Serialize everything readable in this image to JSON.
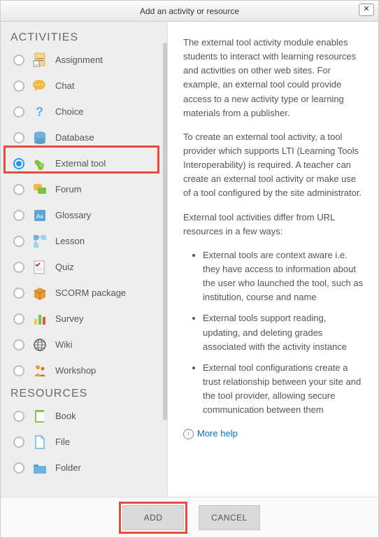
{
  "title": "Add an activity or resource",
  "sections": {
    "activities": "ACTIVITIES",
    "resources": "RESOURCES"
  },
  "activities": [
    {
      "label": "Assignment",
      "icon": "assignment"
    },
    {
      "label": "Chat",
      "icon": "chat"
    },
    {
      "label": "Choice",
      "icon": "choice"
    },
    {
      "label": "Database",
      "icon": "database"
    },
    {
      "label": "External tool",
      "icon": "external-tool",
      "selected": true
    },
    {
      "label": "Forum",
      "icon": "forum"
    },
    {
      "label": "Glossary",
      "icon": "glossary"
    },
    {
      "label": "Lesson",
      "icon": "lesson"
    },
    {
      "label": "Quiz",
      "icon": "quiz"
    },
    {
      "label": "SCORM package",
      "icon": "scorm"
    },
    {
      "label": "Survey",
      "icon": "survey"
    },
    {
      "label": "Wiki",
      "icon": "wiki"
    },
    {
      "label": "Workshop",
      "icon": "workshop"
    }
  ],
  "resources": [
    {
      "label": "Book",
      "icon": "book"
    },
    {
      "label": "File",
      "icon": "file"
    },
    {
      "label": "Folder",
      "icon": "folder"
    }
  ],
  "description": {
    "p1": "The external tool activity module enables students to interact with learning resources and activities on other web sites. For example, an external tool could provide access to a new activity type or learning materials from a publisher.",
    "p2": "To create an external tool activity, a tool provider which supports LTI (Learning Tools Interoperability) is required. A teacher can create an external tool activity or make use of a tool configured by the site administrator.",
    "p3": "External tool activities differ from URL resources in a few ways:",
    "bullets": [
      "External tools are context aware i.e. they have access to information about the user who launched the tool, such as institution, course and name",
      "External tools support reading, updating, and deleting grades associated with the activity instance",
      "External tool configurations create a trust relationship between your site and the tool provider, allowing secure communication between them"
    ],
    "more_help": "More help"
  },
  "buttons": {
    "add": "ADD",
    "cancel": "CANCEL"
  }
}
